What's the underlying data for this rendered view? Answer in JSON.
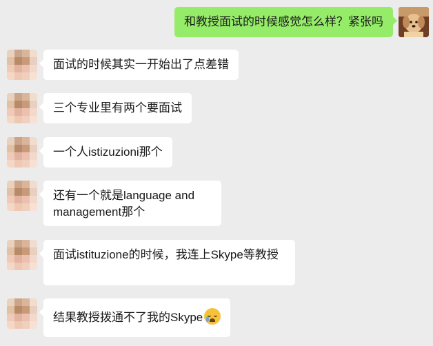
{
  "me": {
    "message": "和教授面试的时候感觉怎么样？紧张吗",
    "avatar_icon": "dog-avatar-icon"
  },
  "contact": {
    "avatar_icon": "blurred-avatar-icon"
  },
  "messages": [
    "面试的时候其实一开始出了点差错",
    "三个专业里有两个要面试",
    "一个人istizuzioni那个",
    "还有一个就是language and management那个",
    "面试istituzione的时候，我连上Skype等教授",
    "结果教授拨通不了我的Skype"
  ],
  "emoji": "crying-face-emoji",
  "colors": {
    "background": "#ececec",
    "my_bubble": "#95ec69",
    "their_bubble": "#ffffff"
  }
}
